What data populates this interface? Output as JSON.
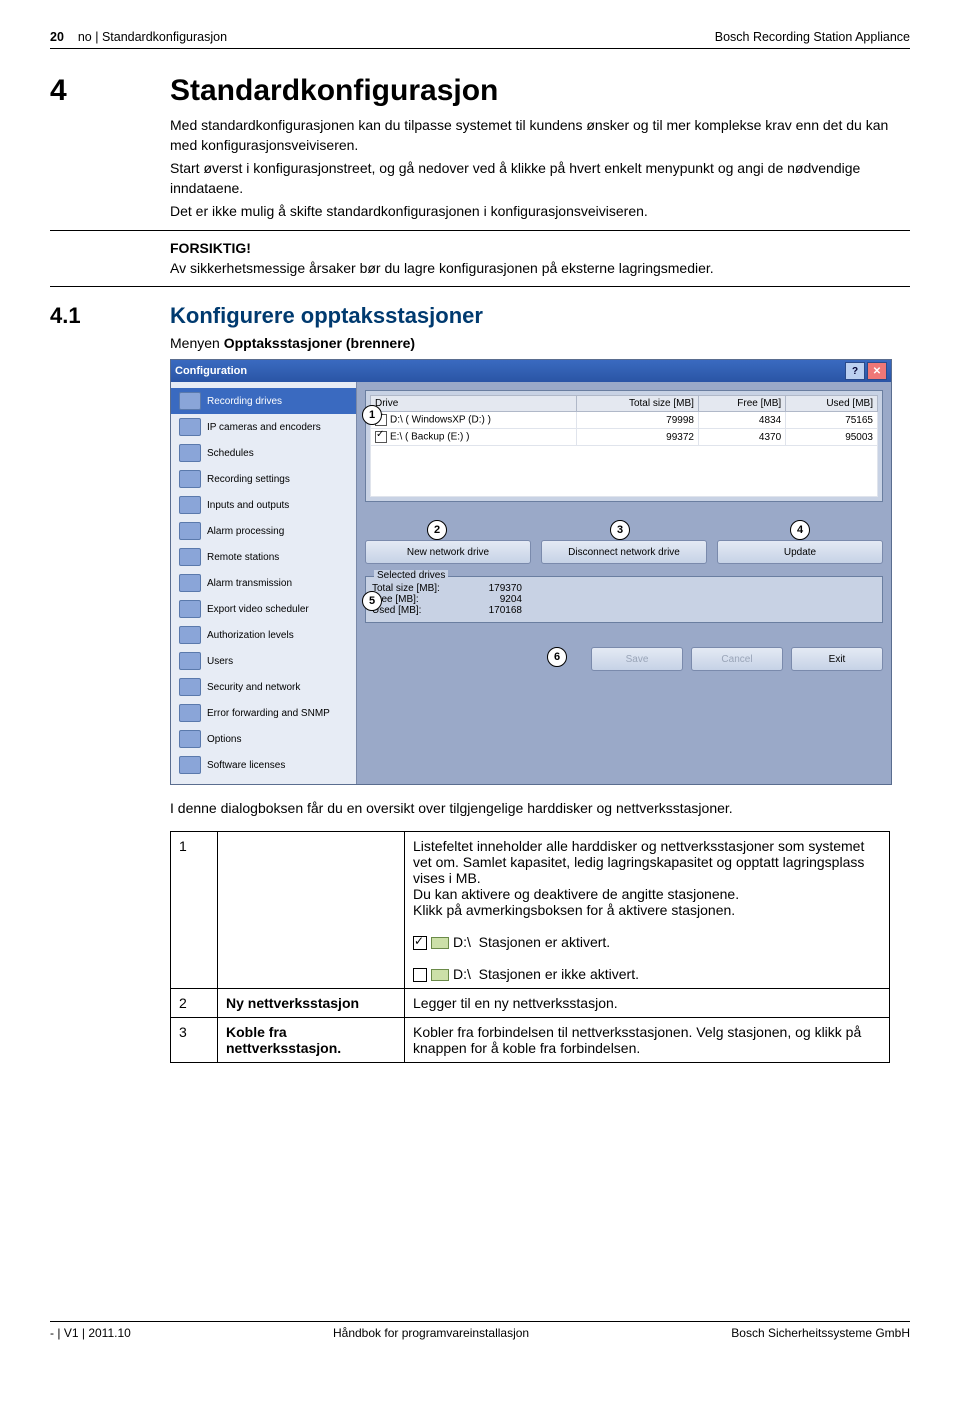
{
  "header": {
    "left_page": "20",
    "left_lang": "no",
    "left_sep": "|",
    "left_title": "Standardkonfigurasjon",
    "right": "Bosch Recording Station Appliance"
  },
  "section": {
    "num": "4",
    "title": "Standardkonfigurasjon",
    "para1": "Med standardkonfigurasjonen kan du tilpasse systemet til kundens ønsker og til mer komplekse krav enn det du kan med konfigurasjonsveiviseren.",
    "para2": "Start øverst i konfigurasjonstreet, og gå nedover ved å klikke på hvert enkelt menypunkt og angi de nødvendige inndataene.",
    "para3": "Det er ikke mulig å skifte standardkonfigurasjonen i konfigurasjonsveiviseren.",
    "caution_head": "FORSIKTIG!",
    "caution_text": "Av sikkerhetsmessige årsaker bør du lagre konfigurasjonen på eksterne lagringsmedier."
  },
  "subsection": {
    "num": "4.1",
    "title": "Konfigurere opptaksstasjoner",
    "menu_prefix": "Menyen ",
    "menu_bold": "Opptaksstasjoner (brennere)"
  },
  "shot": {
    "title": "Configuration",
    "sidebar": [
      "Recording drives",
      "IP cameras and encoders",
      "Schedules",
      "Recording settings",
      "Inputs and outputs",
      "Alarm processing",
      "Remote stations",
      "Alarm transmission",
      "Export video scheduler",
      "Authorization levels",
      "Users",
      "Security and network",
      "Error forwarding and SNMP",
      "Options",
      "Software licenses"
    ],
    "table": {
      "headers": [
        "Drive",
        "Total size [MB]",
        "Free [MB]",
        "Used [MB]"
      ],
      "rows": [
        {
          "drive": "D:\\ ( WindowsXP (D:) )",
          "total": "79998",
          "free": "4834",
          "used": "75165"
        },
        {
          "drive": "E:\\ ( Backup (E:) )",
          "total": "99372",
          "free": "4370",
          "used": "95003"
        }
      ]
    },
    "buttons": {
      "new_drive": "New network drive",
      "disconnect": "Disconnect network drive",
      "update": "Update"
    },
    "summary": {
      "title": "Selected drives",
      "total_label": "Total size [MB]:",
      "total_val": "179370",
      "free_label": "Free [MB]:",
      "free_val": "9204",
      "used_label": "Used [MB]:",
      "used_val": "170168"
    },
    "bottom": {
      "save": "Save",
      "cancel": "Cancel",
      "exit": "Exit"
    },
    "callouts": {
      "c1": "1",
      "c2": "2",
      "c3": "3",
      "c4": "4",
      "c5": "5",
      "c6": "6"
    }
  },
  "desc": {
    "intro": "I denne dialogboksen får du en oversikt over tilgjengelige harddisker og nettverksstasjoner.",
    "rows": [
      {
        "n": "1",
        "label": "",
        "text1": "Listefeltet inneholder alle harddisker og nettverksstasjoner som systemet vet om. Samlet kapasitet, ledig lagringskapasitet og opptatt lagringsplass vises i MB.",
        "text2": "Du kan aktivere og deaktivere de angitte stasjonene.",
        "text3": "Klikk på avmerkingsboksen for å aktivere stasjonen.",
        "act_on": "Stasjonen er aktivert.",
        "act_off": "Stasjonen er ikke aktivert.",
        "drive_label": "D:\\"
      },
      {
        "n": "2",
        "label": "Ny nettverksstasjon",
        "text": "Legger til en ny nettverksstasjon."
      },
      {
        "n": "3",
        "label": "Koble fra nettverksstasjon.",
        "text": "Kobler fra forbindelsen til nettverksstasjonen. Velg stasjonen, og klikk på knappen for å koble fra forbindelsen."
      }
    ]
  },
  "footer": {
    "left_a": "-",
    "left_sep": "|",
    "left_b": "V1",
    "left_c": "2011.10",
    "center": "Håndbok for programvareinstallasjon",
    "right": "Bosch Sicherheitssysteme GmbH"
  }
}
